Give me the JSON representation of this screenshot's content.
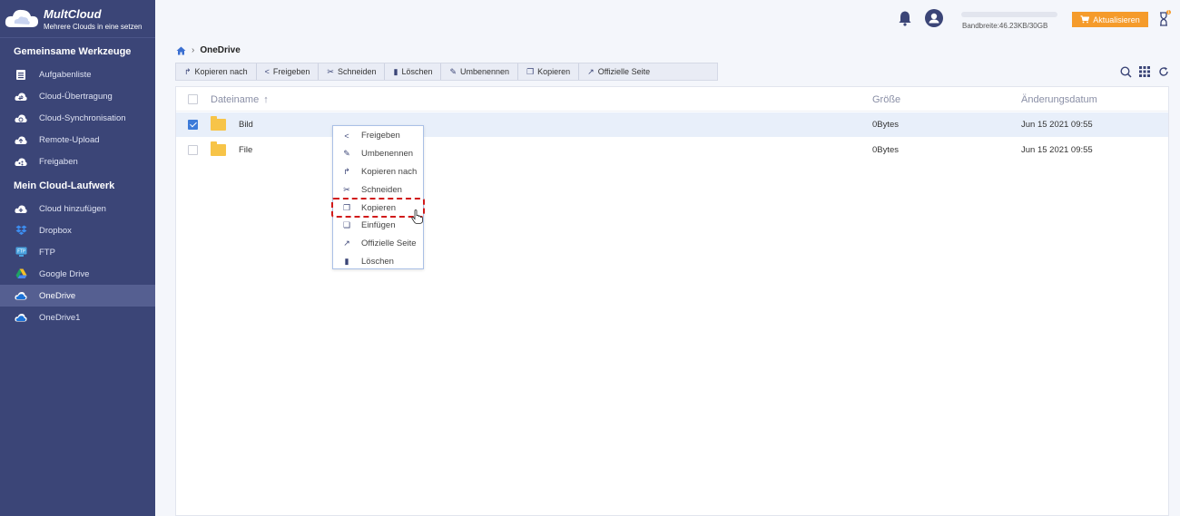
{
  "brand": {
    "name": "MultCloud",
    "tagline": "Mehrere Clouds in eine setzen"
  },
  "sidebar": {
    "section1_title": "Gemeinsame Werkzeuge",
    "tools": [
      {
        "label": "Aufgabenliste",
        "icon": "task-list-icon"
      },
      {
        "label": "Cloud-Übertragung",
        "icon": "cloud-transfer-icon"
      },
      {
        "label": "Cloud-Synchronisation",
        "icon": "cloud-sync-icon"
      },
      {
        "label": "Remote-Upload",
        "icon": "remote-upload-icon"
      },
      {
        "label": "Freigaben",
        "icon": "share-cloud-icon"
      }
    ],
    "section2_title": "Mein Cloud-Laufwerk",
    "drives": [
      {
        "label": "Cloud hinzufügen",
        "icon": "add-cloud-icon"
      },
      {
        "label": "Dropbox",
        "icon": "dropbox-icon"
      },
      {
        "label": "FTP",
        "icon": "ftp-icon"
      },
      {
        "label": "Google Drive",
        "icon": "google-drive-icon"
      },
      {
        "label": "OneDrive",
        "icon": "onedrive-icon",
        "active": true
      },
      {
        "label": "OneDrive1",
        "icon": "onedrive-icon"
      }
    ]
  },
  "topbar": {
    "bandwidth": "Bandbreite:46.23KB/30GB",
    "upgrade_label": "Aktualisieren",
    "notification_badge": "1"
  },
  "breadcrumb": {
    "current": "OneDrive"
  },
  "toolbar": {
    "buttons": [
      "Kopieren nach",
      "Freigeben",
      "Schneiden",
      "Löschen",
      "Umbenennen",
      "Kopieren",
      "Offizielle Seite"
    ]
  },
  "filelist": {
    "headers": {
      "name": "Dateiname",
      "sort_indicator": "↑",
      "size": "Größe",
      "date": "Änderungsdatum"
    },
    "rows": [
      {
        "name": "Bild",
        "size": "0Bytes",
        "date": "Jun 15 2021 09:55",
        "selected": true
      },
      {
        "name": "File",
        "size": "0Bytes",
        "date": "Jun 15 2021 09:55",
        "selected": false
      }
    ]
  },
  "context_menu": {
    "items": [
      "Freigeben",
      "Umbenennen",
      "Kopieren nach",
      "Schneiden",
      "Kopieren",
      "Einfügen",
      "Offizielle Seite",
      "Löschen"
    ],
    "highlighted": "Kopieren"
  },
  "colors": {
    "sidebar": "#3b4577",
    "accent": "#3d7bd9",
    "upgrade": "#f59b2b",
    "highlight": "#d11a1a",
    "folder": "#f7c448"
  }
}
